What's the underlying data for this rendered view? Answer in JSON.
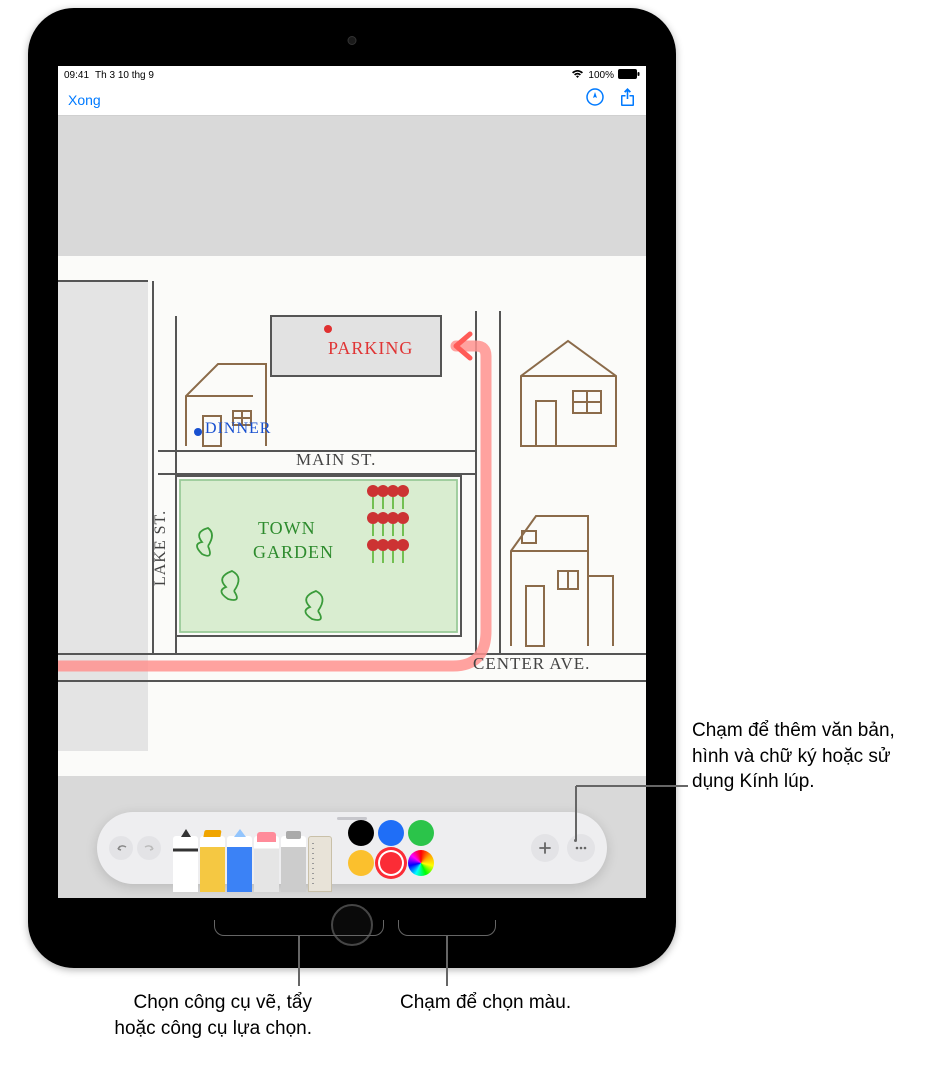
{
  "status": {
    "time": "09:41",
    "date": "Th 3 10 thg 9",
    "battery": "100%"
  },
  "nav": {
    "done": "Xong"
  },
  "sketch": {
    "parking": "PARKING",
    "dinner": "DINNER",
    "main_st": "MAIN ST.",
    "lake_st": "LAKE ST.",
    "town_garden_1": "TOWN",
    "town_garden_2": "GARDEN",
    "center_ave": "CENTER AVE."
  },
  "colors": {
    "black": "#000000",
    "blue": "#1f6ef7",
    "green": "#2bc44a",
    "yellow": "#fbc02d",
    "red": "#fb2c36"
  },
  "callouts": {
    "add": "Chạm để thêm văn bản, hình và chữ ký hoặc sử dụng Kính lúp.",
    "tools": "Chọn công cụ vẽ, tẩy hoặc công cụ lựa chọn.",
    "color": "Chạm để chọn màu."
  }
}
